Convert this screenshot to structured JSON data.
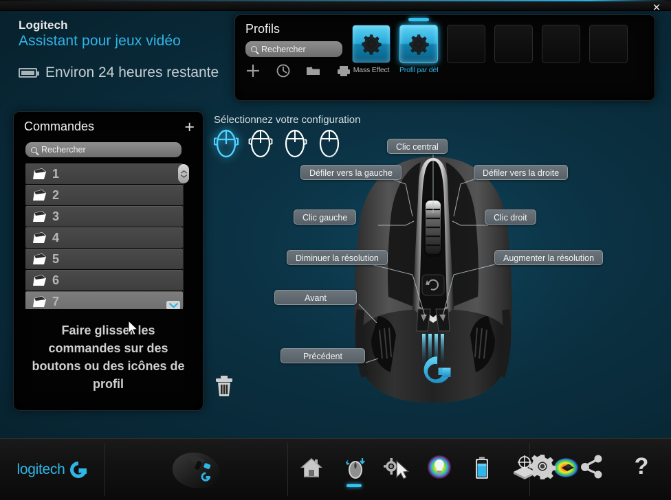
{
  "window": {
    "close_label": "✕"
  },
  "header": {
    "brand": "Logitech",
    "product": "Assistant pour jeux vidéo",
    "battery_status": "Environ 24 heures restante",
    "battery_icon": "battery-icon"
  },
  "profiles": {
    "title": "Profils",
    "search_placeholder": "Rechercher",
    "search_value": "",
    "tools": [
      {
        "name": "add-profile-icon",
        "label": "+"
      },
      {
        "name": "recent-profiles-icon",
        "label": "clock"
      },
      {
        "name": "open-profile-icon",
        "label": "folder"
      },
      {
        "name": "print-profile-icon",
        "label": "printer"
      }
    ],
    "slots": [
      {
        "label": "Mass Effect",
        "filled": true,
        "active": false
      },
      {
        "label": "Profil par déf",
        "filled": true,
        "active": true
      },
      {
        "label": "",
        "filled": false,
        "active": false
      },
      {
        "label": "",
        "filled": false,
        "active": false
      },
      {
        "label": "",
        "filled": false,
        "active": false
      },
      {
        "label": "",
        "filled": false,
        "active": false
      }
    ]
  },
  "commands": {
    "title": "Commandes",
    "add_label": "+",
    "search_placeholder": "Rechercher",
    "search_value": "",
    "rows": [
      {
        "label": "1",
        "highlighted": false
      },
      {
        "label": "2",
        "highlighted": false
      },
      {
        "label": "3",
        "highlighted": false
      },
      {
        "label": "4",
        "highlighted": false
      },
      {
        "label": "5",
        "highlighted": false
      },
      {
        "label": "6",
        "highlighted": false
      },
      {
        "label": "7",
        "highlighted": true
      }
    ],
    "hint": "Faire glisser les commandes sur des boutons ou des icônes de profil"
  },
  "configuration": {
    "label": "Sélectionnez votre configuration",
    "options": [
      {
        "name": "config-1",
        "active": true
      },
      {
        "name": "config-2",
        "active": false
      },
      {
        "name": "config-3",
        "active": false
      },
      {
        "name": "config-4",
        "active": false
      }
    ]
  },
  "mouse_assignments": [
    {
      "name": "middle-click",
      "label": "Clic central"
    },
    {
      "name": "scroll-left",
      "label": "Défiler vers la gauche"
    },
    {
      "name": "scroll-right",
      "label": "Défiler vers la droite"
    },
    {
      "name": "left-click",
      "label": "Clic gauche"
    },
    {
      "name": "right-click",
      "label": "Clic droit"
    },
    {
      "name": "dpi-down",
      "label": "Diminuer la résolution"
    },
    {
      "name": "dpi-up",
      "label": "Augmenter la résolution"
    },
    {
      "name": "forward",
      "label": "Avant"
    },
    {
      "name": "back",
      "label": "Précédent"
    }
  ],
  "trash": {
    "name": "delete-icon"
  },
  "bottombar": {
    "logo_text": "logitech",
    "device_name": "mouse-device",
    "tools": [
      {
        "name": "home-icon",
        "active": false
      },
      {
        "name": "mouse-settings-icon",
        "active": true
      },
      {
        "name": "pointer-settings-icon",
        "active": false
      },
      {
        "name": "lighting-icon",
        "active": false
      },
      {
        "name": "battery-settings-icon",
        "active": false
      },
      {
        "name": "surface-tuning-icon",
        "active": false
      },
      {
        "name": "heatmap-icon",
        "active": false
      }
    ],
    "right_tools": [
      {
        "name": "gear-icon"
      },
      {
        "name": "share-icon"
      },
      {
        "name": "help-icon"
      }
    ]
  },
  "colors": {
    "accent": "#2fb6e8",
    "background": "#0a2e3e",
    "panel": "#050505",
    "label_bg": "#6c757b"
  }
}
